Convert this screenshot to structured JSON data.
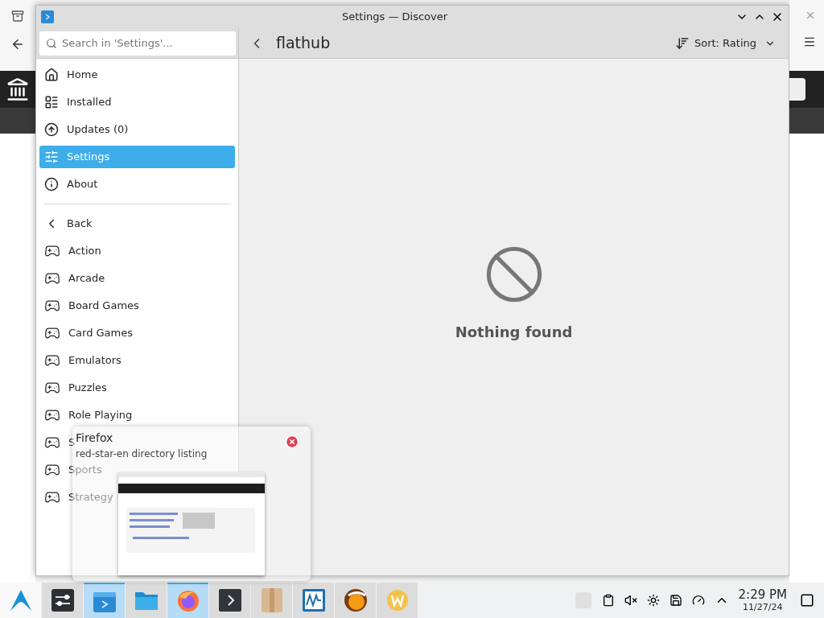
{
  "window": {
    "title": "Settings — Discover"
  },
  "search": {
    "placeholder": "Search in 'Settings'..."
  },
  "nav": [
    {
      "label": "Home",
      "selected": false
    },
    {
      "label": "Installed",
      "selected": false
    },
    {
      "label": "Updates (0)",
      "selected": false
    },
    {
      "label": "Settings",
      "selected": true
    },
    {
      "label": "About",
      "selected": false
    }
  ],
  "back": "Back",
  "categories": [
    "Action",
    "Arcade",
    "Board Games",
    "Card Games",
    "Emulators",
    "Puzzles",
    "Role Playing",
    "S",
    "Sports",
    "Strategy"
  ],
  "header": {
    "title": "flathub",
    "sort": "Sort: Rating"
  },
  "empty_message": "Nothing found",
  "tooltip": {
    "title": "Firefox",
    "subtitle": "red-star-en directory listing"
  },
  "taskbar": [
    {
      "selected": false
    },
    {
      "selected": false
    },
    {
      "selected": true
    },
    {
      "selected": false
    },
    {
      "selected": true
    },
    {
      "selected": false
    },
    {
      "selected": false
    },
    {
      "selected": false
    },
    {
      "selected": false
    },
    {
      "selected": false
    }
  ],
  "clock": {
    "time": "2:29 PM",
    "date": "11/27/24"
  }
}
